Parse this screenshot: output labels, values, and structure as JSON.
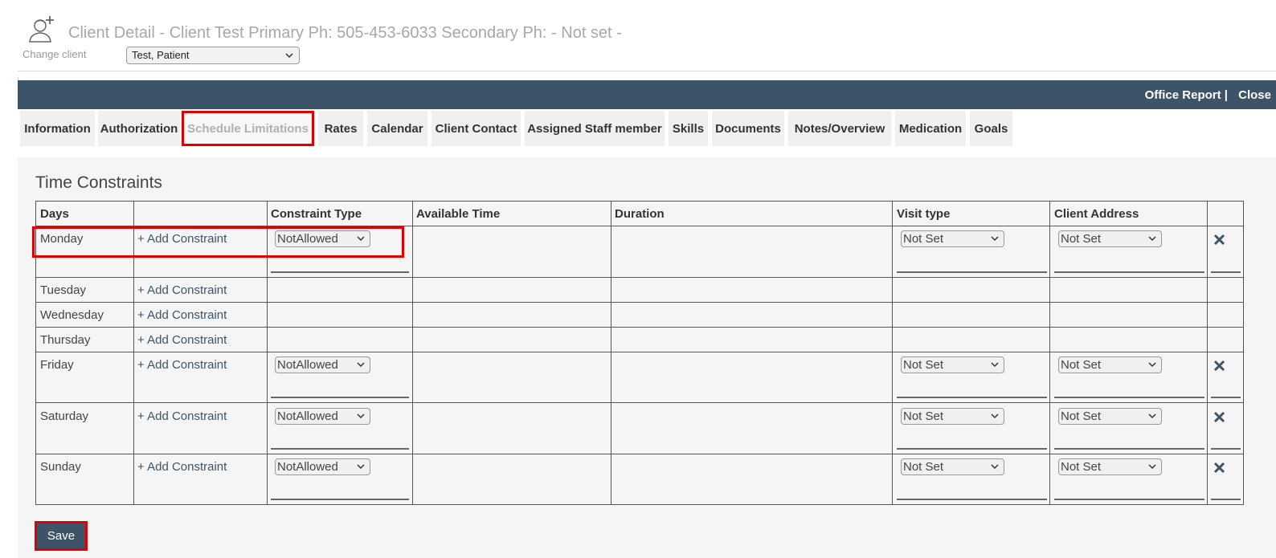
{
  "header": {
    "title": "Client Detail - Client Test Primary Ph: 505-453-6033 Secondary Ph: - Not set -",
    "change_client_label": "Change client",
    "client_select_value": "Test, Patient"
  },
  "topbar": {
    "office_report": "Office Report |",
    "close": "Close"
  },
  "tabs": [
    {
      "label": "Information"
    },
    {
      "label": "Authorization"
    },
    {
      "label": "Schedule Limitations",
      "active": true
    },
    {
      "label": "Rates"
    },
    {
      "label": "Calendar"
    },
    {
      "label": "Client Contact"
    },
    {
      "label": "Assigned Staff member"
    },
    {
      "label": "Skills"
    },
    {
      "label": "Documents"
    },
    {
      "label": "Notes/Overview"
    },
    {
      "label": "Medication"
    },
    {
      "label": "Goals"
    }
  ],
  "section_title": "Time Constraints",
  "table": {
    "headers": [
      "Days",
      "",
      "Constraint Type",
      "Available Time",
      "Duration",
      "Visit type",
      "Client Address",
      ""
    ],
    "add_label": "+ Add Constraint",
    "rows": [
      {
        "day": "Monday",
        "constraint": "NotAllowed",
        "visit_type": "Not Set",
        "address": "Not Set"
      },
      {
        "day": "Tuesday"
      },
      {
        "day": "Wednesday"
      },
      {
        "day": "Thursday"
      },
      {
        "day": "Friday",
        "constraint": "NotAllowed",
        "visit_type": "Not Set",
        "address": "Not Set"
      },
      {
        "day": "Saturday",
        "constraint": "NotAllowed",
        "visit_type": "Not Set",
        "address": "Not Set"
      },
      {
        "day": "Sunday",
        "constraint": "NotAllowed",
        "visit_type": "Not Set",
        "address": "Not Set"
      }
    ]
  },
  "save_label": "Save",
  "icons": {
    "client": "client-add-icon",
    "chevron": "chevron-down-icon",
    "remove": "remove-constraint-icon"
  },
  "colors": {
    "topbar": "#3d5468",
    "highlight": "#e00000",
    "link": "#3d5468",
    "content_bg": "#f5f5f5"
  }
}
